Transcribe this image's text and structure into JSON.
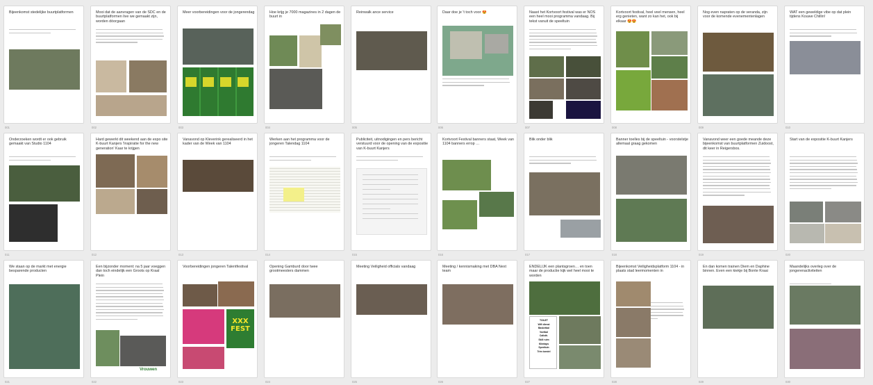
{
  "cards": [
    {
      "title": "Bijeenkomst stedelijke buurtplatformen"
    },
    {
      "title": "Mooi dat de aanvragen van de SDC en de buurtplatformen live we gemaakt zijn, worden dóorgaan"
    },
    {
      "title": "Meer voorbereidingen voor de jongerendag"
    },
    {
      "title": "Hoe krijg je 7000 magazines in 2 dagen de buurt in"
    },
    {
      "title": "Reinwalk ance service"
    },
    {
      "title": "Daar doe je 't toch voor 😍"
    },
    {
      "title": "Naast het Kortvoort festival was er NOS een heel mooi programma vandaag. Bij tekst vanuit de speeltuin"
    },
    {
      "title": "Kortvoort festival, heel veel mensen, heel erg genieten, want zo kan het, ook bij elkaar 😍😍"
    },
    {
      "title": "Nog even napraten op de veranda, zijn voor de komende evenementenlagen"
    },
    {
      "title": "WAT een geweldige vibe op dat plein tijdens Kouwe Chillin!"
    },
    {
      "title": "Onderzoeken wordt er ook gebruik gemaakt van Studio 1104"
    },
    {
      "title": "Hard gewerkt dit weekend aan de expo site K-buurt Kanjers 'Inspiratie for the new generation' Kaar te krijgen"
    },
    {
      "title": "Vanavond op Kleverink gerealiseerd in het kader van de Week van 1104"
    },
    {
      "title": "Werken aan het programma voor de jongeren Talendag 1104"
    },
    {
      "title": "Publiciteit, uitnodigingen en pers bericht verstuurd voor de opening van de expositie van K-buurt Kanjers"
    },
    {
      "title": "Kortvoort Festival banners staat, Week van 1104 banners errop …"
    },
    {
      "title": "Blik onder blik"
    },
    {
      "title": "Banner toelles bij de speeltuin - voorstelstje allemaal graag gekomen"
    },
    {
      "title": "Vanavond weer een goede meande deze bijeenkomst van buurtplatformen Zuidoost, dit keer in Reigersbos."
    },
    {
      "title": "Start van de expositie K-buurt Kanjers"
    },
    {
      "title": "We staan op de markt met energie besparende producten"
    },
    {
      "title": "Een bijzonder moment: na 5 jaar voeggen dan toch eindelijk een Groots op Kraal Plein"
    },
    {
      "title": "Voorbereidingen jongeren Talentfestival"
    },
    {
      "title": "Opening Gamburd door twee grootmeesters dammen"
    },
    {
      "title": "Meeting Veiligheid officials vandaag"
    },
    {
      "title": "Meeting / kennismaking met DBA Next team"
    },
    {
      "title": "ENDELIJK een plantsgroen… en toen maar de productie kijk wel heel mooi te worden"
    },
    {
      "title": "Bijeenkomst Veiligheidsplatform 1104 - in plaats stad leermomenten in"
    },
    {
      "title": "En dan komen trainen Diem en Daphine binnen. Even een kiekje bij Bonte Kraai"
    },
    {
      "title": "Maandelijks overleg over de jongerenactiviteiten"
    }
  ],
  "page_numbers": [
    "001",
    "002",
    "003",
    "004",
    "005",
    "006",
    "007",
    "008",
    "009",
    "010",
    "011",
    "012",
    "013",
    "014",
    "015",
    "016",
    "017",
    "018",
    "019",
    "020",
    "021",
    "022",
    "023",
    "024",
    "025",
    "026",
    "027",
    "028",
    "029",
    "030"
  ],
  "xxx_fest_label": "XXX FEST",
  "poster_lines": [
    "TOILET",
    "Wifi dienst",
    "Basketbal",
    "Voetbal",
    "Calisth.",
    "Skill ruim",
    "Klimtaps",
    "Speeltuin",
    "Trim toestel"
  ],
  "logo_text": "Vrouwen",
  "colors": {
    "background": "#ececec",
    "card": "#ffffff",
    "card_border": "#d9d9d9",
    "title": "#333333",
    "meta": "#9a9a9a",
    "green_shirt": "#3d8b3d",
    "fest_green": "#2e7d32",
    "fest_yellow": "#f5e62a",
    "pink": "#d63a7c"
  }
}
